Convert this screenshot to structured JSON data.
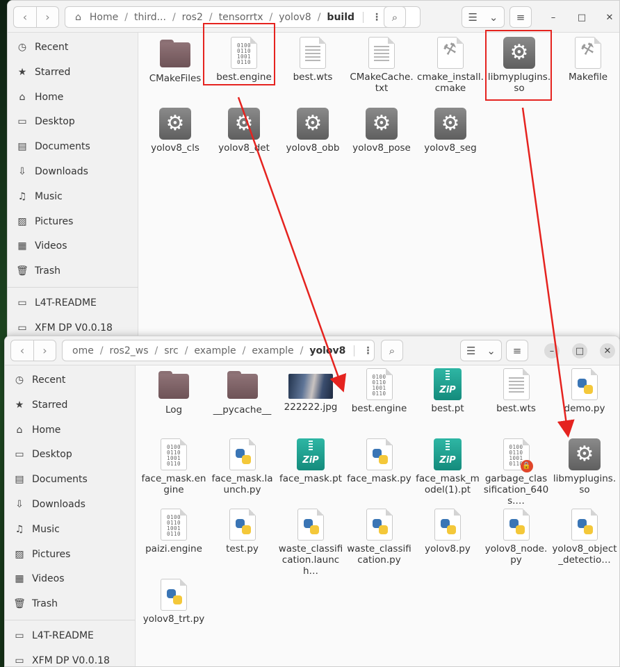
{
  "window1": {
    "path": [
      "Home",
      "third...",
      "ros2",
      "tensorrtx",
      "yolov8",
      "build"
    ],
    "sidebar": [
      "Recent",
      "Starred",
      "Home",
      "Desktop",
      "Documents",
      "Downloads",
      "Music",
      "Pictures",
      "Videos",
      "Trash",
      "L4T-README",
      "XFM DP V0.0.18"
    ],
    "files": [
      {
        "name": "CMakeFiles",
        "type": "folder"
      },
      {
        "name": "best.engine",
        "type": "binary"
      },
      {
        "name": "best.wts",
        "type": "text"
      },
      {
        "name": "CMakeCache.txt",
        "type": "text"
      },
      {
        "name": "cmake_install.cmake",
        "type": "make"
      },
      {
        "name": "libmyplugins.so",
        "type": "library"
      },
      {
        "name": "Makefile",
        "type": "make"
      },
      {
        "name": "yolov8_cls",
        "type": "executable"
      },
      {
        "name": "yolov8_det",
        "type": "executable"
      },
      {
        "name": "yolov8_obb",
        "type": "executable"
      },
      {
        "name": "yolov8_pose",
        "type": "executable"
      },
      {
        "name": "yolov8_seg",
        "type": "executable"
      }
    ]
  },
  "window2": {
    "path": [
      "ome",
      "ros2_ws",
      "src",
      "example",
      "example",
      "yolov8"
    ],
    "sidebar": [
      "Recent",
      "Starred",
      "Home",
      "Desktop",
      "Documents",
      "Downloads",
      "Music",
      "Pictures",
      "Videos",
      "Trash",
      "L4T-README",
      "XFM DP V0.0.18"
    ],
    "files": [
      {
        "name": "Log",
        "type": "folder"
      },
      {
        "name": "__pycache__",
        "type": "folder"
      },
      {
        "name": "222222.jpg",
        "type": "image"
      },
      {
        "name": "best.engine",
        "type": "binary"
      },
      {
        "name": "best.pt",
        "type": "zip"
      },
      {
        "name": "best.wts",
        "type": "text"
      },
      {
        "name": "demo.py",
        "type": "python"
      },
      {
        "name": "face_mask.engine",
        "type": "binary"
      },
      {
        "name": "face_mask.launch.py",
        "type": "python"
      },
      {
        "name": "face_mask.pt",
        "type": "zip"
      },
      {
        "name": "face_mask.py",
        "type": "python"
      },
      {
        "name": "face_mask_model(1).pt",
        "type": "zip"
      },
      {
        "name": "garbage_classification_640s.…",
        "type": "binary-locked"
      },
      {
        "name": "libmyplugins.so",
        "type": "library"
      },
      {
        "name": "paizi.engine",
        "type": "binary"
      },
      {
        "name": "test.py",
        "type": "python"
      },
      {
        "name": "waste_classification.launch…",
        "type": "python"
      },
      {
        "name": "waste_classification.py",
        "type": "python"
      },
      {
        "name": "yolov8.py",
        "type": "python"
      },
      {
        "name": "yolov8_node.py",
        "type": "python"
      },
      {
        "name": "yolov8_object_detectio…",
        "type": "python"
      },
      {
        "name": "yolov8_trt.py",
        "type": "python"
      }
    ]
  },
  "icons": {
    "Recent": "clock-icon",
    "Starred": "star-icon",
    "Home": "home-icon",
    "Desktop": "desktop-icon",
    "Documents": "documents-icon",
    "Downloads": "downloads-icon",
    "Music": "music-icon",
    "Pictures": "pictures-icon",
    "Videos": "videos-icon",
    "Trash": "trash-icon",
    "L4T-README": "drive-icon",
    "XFM DP V0.0.18": "drive-icon"
  },
  "annotation_color": "#e5231f"
}
